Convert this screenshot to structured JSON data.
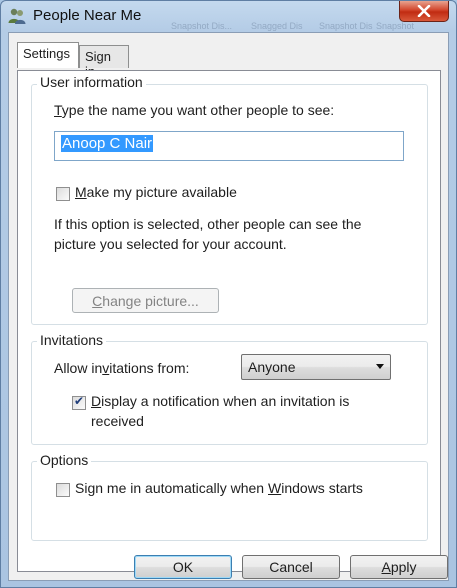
{
  "window": {
    "title": "People Near Me",
    "ghost_labels": [
      "Snapshot Dis...",
      "Snagged Dis",
      "Snapshot Dis",
      "Snapshot"
    ]
  },
  "tabs": [
    {
      "label": "Settings",
      "active": true
    },
    {
      "label": "Sign in",
      "active": false
    }
  ],
  "user_info": {
    "group_label": "User information",
    "name_prompt_mnemonic": "T",
    "name_prompt_rest": "ype the name you want other people to see:",
    "name_value": "Anoop C Nair",
    "picture_checkbox_mnemonic": "M",
    "picture_checkbox_rest": "ake my picture available",
    "picture_checked": false,
    "info_line1": "If this option is selected, other people can see the",
    "info_line2": "picture you selected for your account.",
    "change_picture_mnemonic": "C",
    "change_picture_rest": "hange picture..."
  },
  "invitations": {
    "group_label": "Invitations",
    "allow_label_pre": "Allow in",
    "allow_label_mnemonic": "v",
    "allow_label_post": "itations from:",
    "allow_value": "Anyone",
    "notify_mnemonic": "D",
    "notify_line1_rest": "isplay a notification when an invitation is",
    "notify_line2": "received",
    "notify_checked": true
  },
  "options": {
    "group_label": "Options",
    "signin_pre": "Sign me in automatically when ",
    "signin_mnemonic": "W",
    "signin_post": "indows starts",
    "signin_checked": false
  },
  "buttons": {
    "ok": "OK",
    "cancel": "Cancel",
    "apply_mnemonic": "A",
    "apply_rest": "pply"
  },
  "colors": {
    "selection": "#3399ff",
    "close_button": "#c12b12",
    "frame": "#aac4e1"
  }
}
